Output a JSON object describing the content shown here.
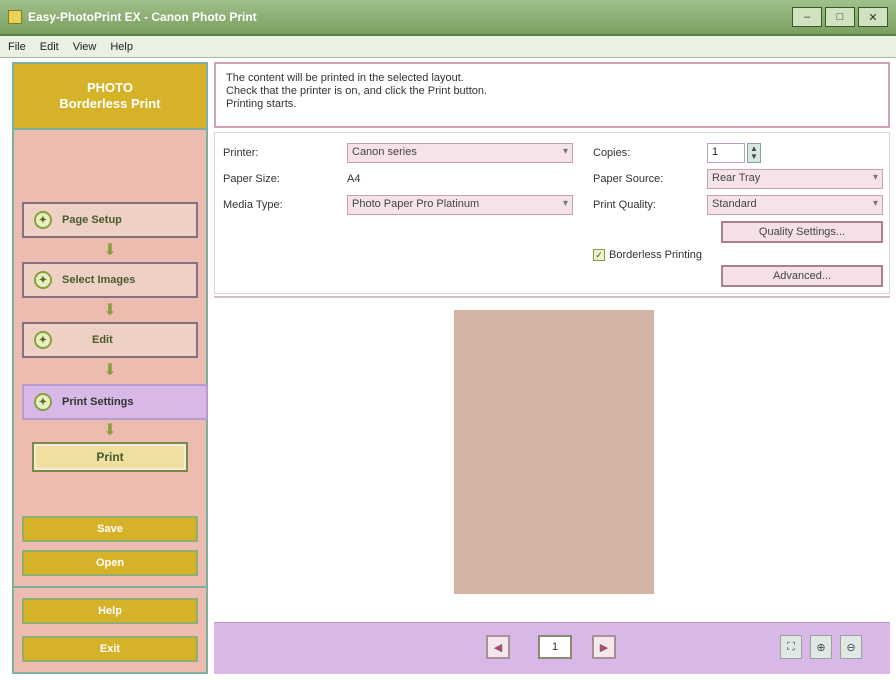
{
  "window": {
    "title": "Easy-PhotoPrint EX - Canon Photo Print",
    "controls": [
      "–",
      "□",
      "✕"
    ]
  },
  "menu": [
    "File",
    "Edit",
    "View",
    "Help"
  ],
  "sidebar": {
    "brand_line1": "PHOTO",
    "brand_line2": "Borderless Print",
    "steps": [
      {
        "label": "Page Setup",
        "icon": "page-setup-icon"
      },
      {
        "label": "Select Images",
        "icon": "images-icon"
      },
      {
        "label": "Edit",
        "icon": "edit-icon"
      },
      {
        "label": "Print Settings",
        "icon": "print-icon"
      }
    ],
    "print_button": "Print",
    "save_button": "Save",
    "open_button": "Open",
    "help_button": "Help",
    "exit_button": "Exit"
  },
  "info": {
    "line1": "The content will be printed in the selected layout.",
    "line2": "Check that the printer is on, and click the Print button.",
    "line3": "Printing starts."
  },
  "settings": {
    "printer_label": "Printer:",
    "printer_value": "Canon series",
    "paper_size_label": "Paper Size:",
    "paper_size_value": "A4",
    "media_type_label": "Media Type:",
    "media_type_value": "Photo Paper Pro Platinum",
    "copies_label": "Copies:",
    "copies_value": "1",
    "paper_source_label": "Paper Source:",
    "paper_source_value": "Rear Tray",
    "print_quality_label": "Print Quality:",
    "print_quality_value": "Standard",
    "quality_settings_button": "Quality Settings...",
    "borderless_label": "Borderless Printing",
    "advanced_button": "Advanced..."
  },
  "preview": {
    "page_number": "1"
  },
  "colors": {
    "accent": "#d6b228",
    "sidebar_bg": "#ecbcb0",
    "active_step": "#d8b8e6",
    "paper": "#d4b4a4"
  }
}
